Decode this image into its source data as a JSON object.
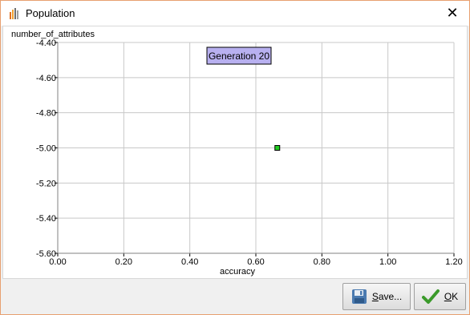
{
  "window": {
    "title": "Population"
  },
  "chart_data": {
    "type": "scatter",
    "title": "",
    "xlabel": "accuracy",
    "ylabel": "number_of_attributes",
    "xlim": [
      0.0,
      1.2
    ],
    "ylim": [
      -5.6,
      -4.4
    ],
    "x_ticks": [
      "0.00",
      "0.20",
      "0.40",
      "0.60",
      "0.80",
      "1.00",
      "1.20"
    ],
    "y_ticks": [
      "-4.40",
      "-4.60",
      "-4.80",
      "-5.00",
      "-5.20",
      "-5.40",
      "-5.60"
    ],
    "grid": true,
    "annotation": "Generation 20",
    "points": [
      {
        "x": 0.665,
        "y": -5.0
      }
    ],
    "colors": {
      "point": "#22cc22",
      "annotation_bg": "#b8b0f0",
      "grid": "#c8c8c8"
    }
  },
  "buttons": {
    "save": {
      "first": "S",
      "rest": "ave..."
    },
    "ok": {
      "first": "O",
      "rest": "K"
    }
  }
}
